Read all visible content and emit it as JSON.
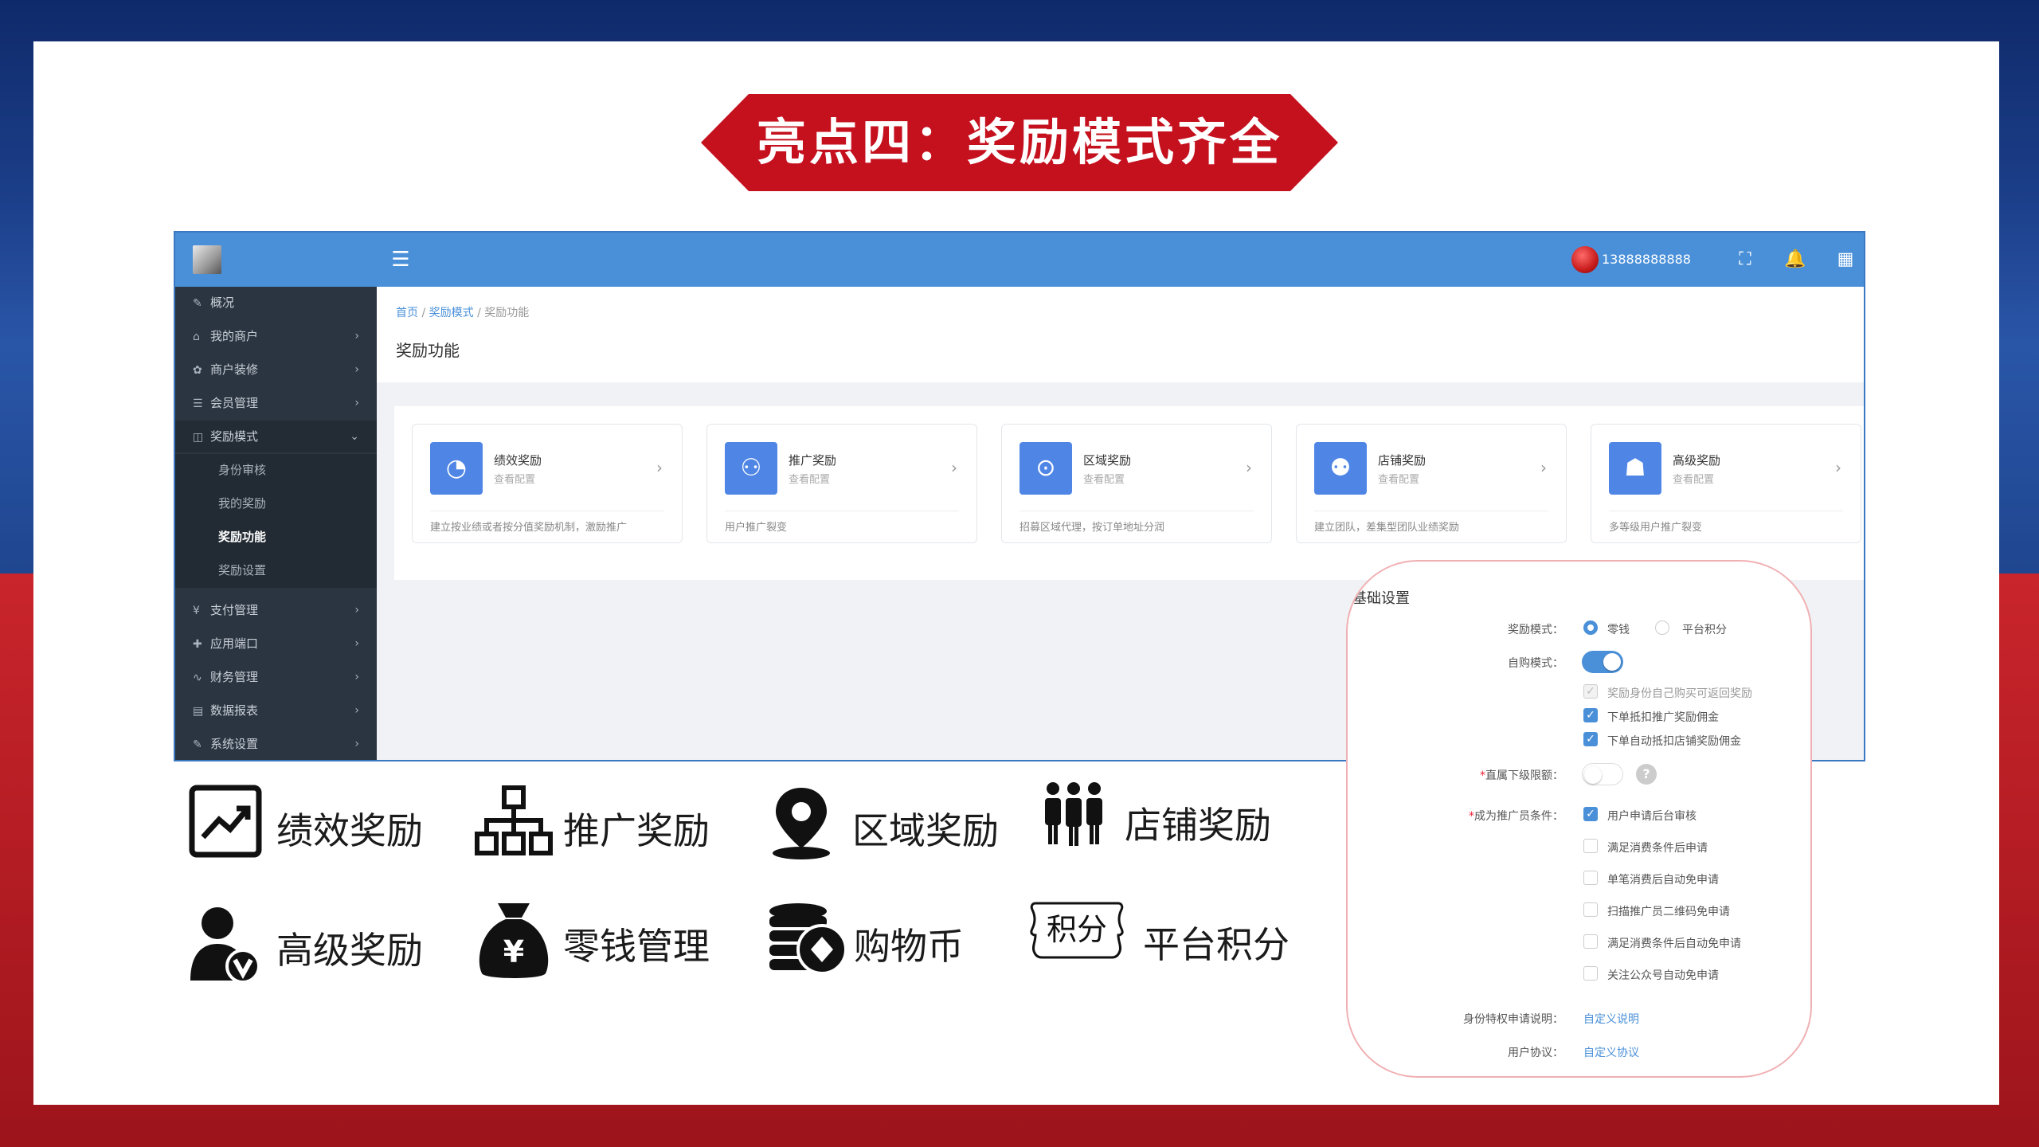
{
  "slide": {
    "title": "亮点四：奖励模式齐全"
  },
  "admin": {
    "username": "13888888888",
    "sidebar": {
      "items": [
        {
          "icon": "✎",
          "label": "概况"
        },
        {
          "icon": "⌂",
          "label": "我的商户"
        },
        {
          "icon": "✿",
          "label": "商户装修"
        },
        {
          "icon": "☰",
          "label": "会员管理"
        },
        {
          "icon": "◫",
          "label": "奖励模式"
        },
        {
          "icon": "¥",
          "label": "支付管理"
        },
        {
          "icon": "✚",
          "label": "应用端口"
        },
        {
          "icon": "∿",
          "label": "财务管理"
        },
        {
          "icon": "▤",
          "label": "数据报表"
        },
        {
          "icon": "✎",
          "label": "系统设置"
        }
      ],
      "subitems": [
        "身份审核",
        "我的奖励",
        "奖励功能",
        "奖励设置"
      ]
    },
    "breadcrumb": {
      "home": "首页",
      "sep": "/",
      "parent": "奖励模式",
      "current": "奖励功能"
    },
    "page_title": "奖励功能",
    "cards": [
      {
        "icon": "◔",
        "title": "绩效奖励",
        "sub": "查看配置",
        "desc": "建立按业绩或者按分值奖励机制，激励推广"
      },
      {
        "icon": "⚇",
        "title": "推广奖励",
        "sub": "查看配置",
        "desc": "用户推广裂变"
      },
      {
        "icon": "⊙",
        "title": "区域奖励",
        "sub": "查看配置",
        "desc": "招募区域代理，按订单地址分润"
      },
      {
        "icon": "⚉",
        "title": "店铺奖励",
        "sub": "查看配置",
        "desc": "建立团队，差集型团队业绩奖励"
      },
      {
        "icon": "☗",
        "title": "高级奖励",
        "sub": "查看配置",
        "desc": "多等级用户推广裂变"
      }
    ]
  },
  "features": [
    {
      "icon": "📈",
      "label": "绩效奖励"
    },
    {
      "icon": "品",
      "label": "推广奖励"
    },
    {
      "icon": "📍",
      "label": "区域奖励"
    },
    {
      "icon": "👪",
      "label": "店铺奖励"
    },
    {
      "icon": "👤",
      "label": "高级奖励"
    },
    {
      "icon": "💰",
      "label": "零钱管理"
    },
    {
      "icon": "🪙",
      "label": "购物币"
    },
    {
      "icon": "积分",
      "label": "平台积分"
    }
  ],
  "settings": {
    "title": "基础设置",
    "reward_mode_label": "奖励模式：",
    "reward_mode_options": [
      "零钱",
      "平台积分"
    ],
    "self_buy_label": "自购模式：",
    "self_buy_checks": [
      "奖励身份自己购买可返回奖励",
      "下单抵扣推广奖励佣金",
      "下单自动抵扣店铺奖励佣金"
    ],
    "direct_limit_label": "直属下级限额：",
    "promoter_cond_label": "成为推广员条件：",
    "promoter_cond_options": [
      "用户申请后台审核",
      "满足消费条件后申请",
      "单笔消费后自动免申请",
      "扫描推广员二维码免申请",
      "满足消费条件后自动免申请",
      "关注公众号自动免申请"
    ],
    "privilege_label": "身份特权申请说明：",
    "privilege_link": "自定义说明",
    "agreement_label": "用户协议：",
    "agreement_link": "自定义协议",
    "help_symbol": "?"
  }
}
